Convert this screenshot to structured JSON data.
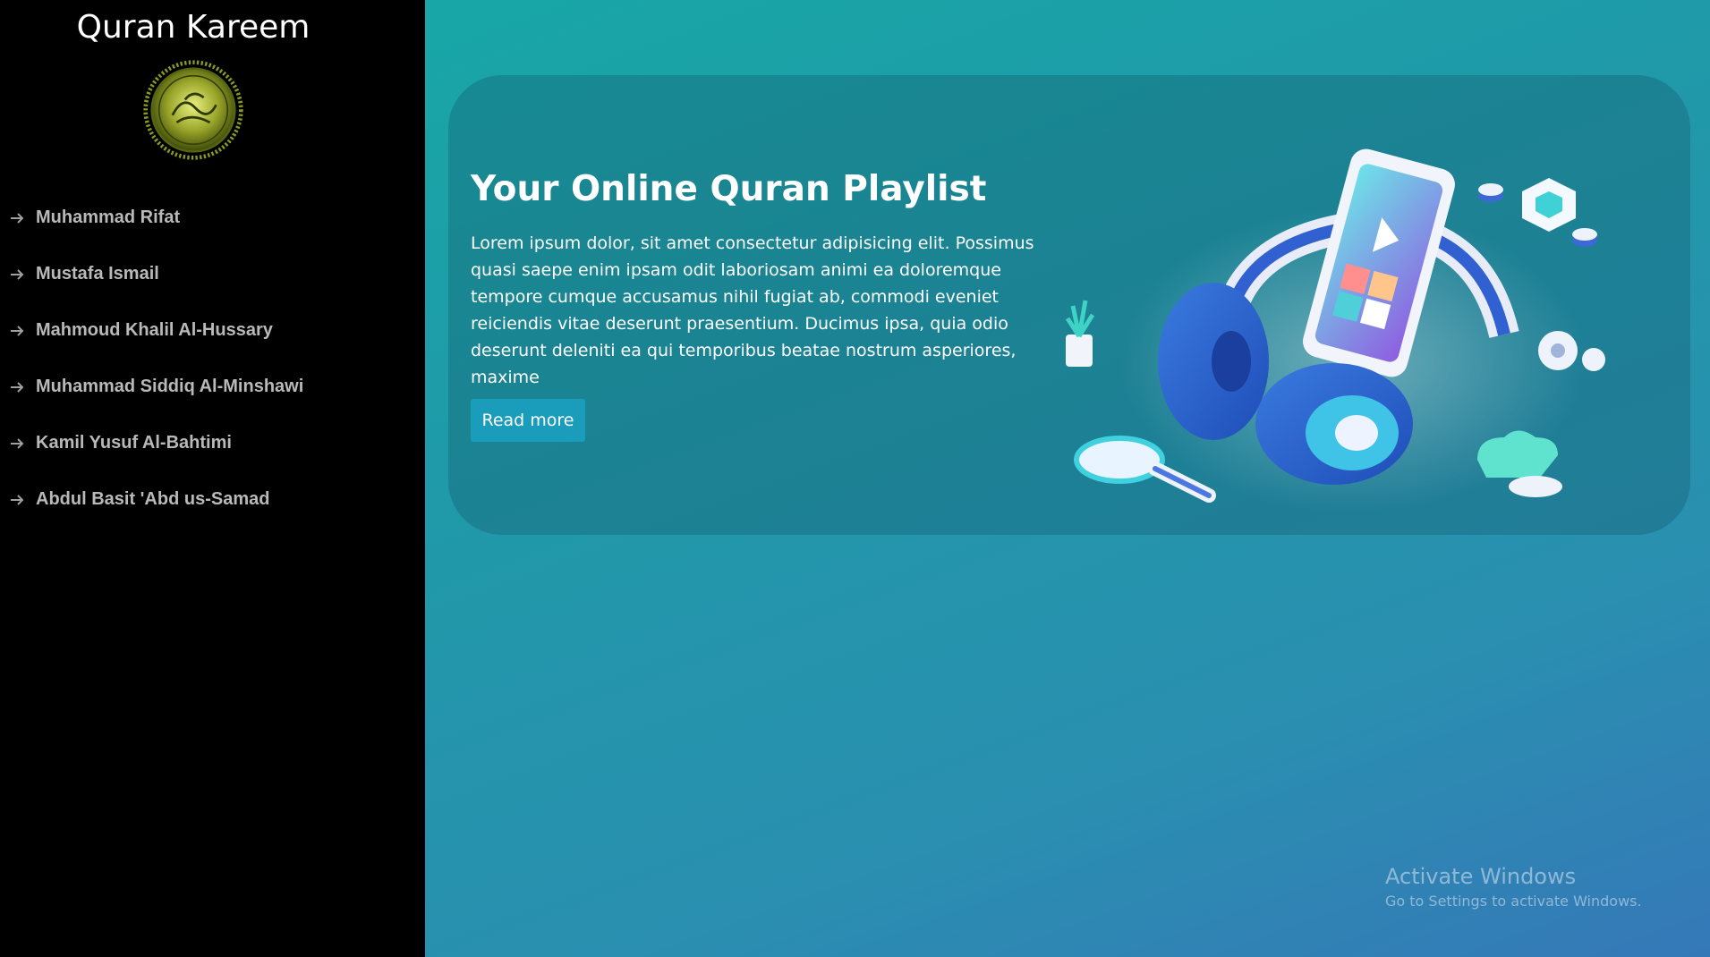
{
  "app": {
    "title": "Quran Kareem"
  },
  "sidebar": {
    "items": [
      {
        "label": "Muhammad Rifat"
      },
      {
        "label": "Mustafa Ismail"
      },
      {
        "label": "Mahmoud Khalil Al-Hussary"
      },
      {
        "label": "Muhammad Siddiq Al-Minshawi"
      },
      {
        "label": "Kamil Yusuf Al-Bahtimi"
      },
      {
        "label": "Abdul Basit 'Abd us-Samad"
      }
    ],
    "item_icon": "arrow-right-icon"
  },
  "hero": {
    "title": "Your Online Quran Playlist",
    "text": "Lorem ipsum dolor, sit amet consectetur adipisicing elit. Possimus quasi saepe enim ipsam odit laboriosam animi ea doloremque tempore cumque accusamus nihil fugiat ab, commodi eveniet reiciendis vitae deserunt praesentium. Ducimus ipsa, quia odio deserunt deleniti ea qui temporibus beatae nostrum asperiores, maxime",
    "button_label": "Read more"
  },
  "watermark": {
    "title": "Activate Windows",
    "subtitle": "Go to Settings to activate Windows."
  },
  "colors": {
    "sidebar_bg": "#000000",
    "nav_text": "#b9b9b9",
    "button_bg": "#1a9cbb",
    "gradient_start": "#16aba6",
    "gradient_end": "#3578b8"
  }
}
